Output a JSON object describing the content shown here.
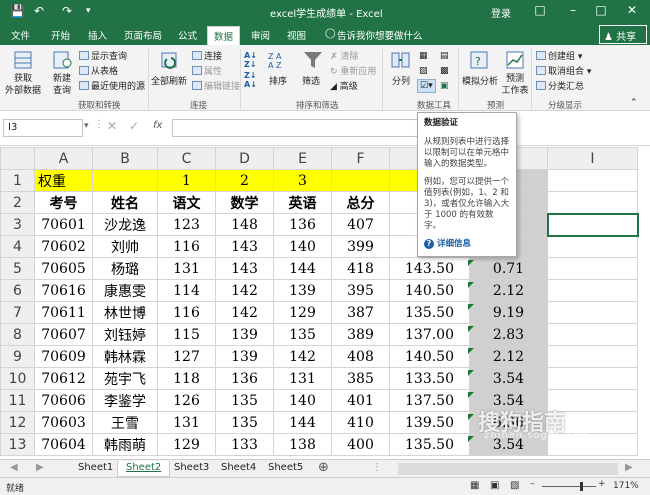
{
  "titlebar": {
    "title": "excel学生成绩单 - Excel",
    "login": "登录",
    "save_icon": "save-icon",
    "undo_icon": "undo-icon",
    "redo_icon": "redo-icon"
  },
  "tabs": [
    "文件",
    "开始",
    "插入",
    "页面布局",
    "公式",
    "数据",
    "审阅",
    "视图"
  ],
  "active_tab": "数据",
  "tell_me": "告诉我你想要做什么",
  "share": "共享",
  "ribbon": {
    "get_external": "获取\n外部数据",
    "new_query": "新建\n查询",
    "show_queries": "显示查询",
    "from_table": "从表格",
    "recent_sources": "最近使用的源",
    "group1": "获取和转换",
    "refresh_all": "全部刷新",
    "connections": "连接",
    "properties": "属性",
    "edit_links": "编辑链接",
    "group2": "连接",
    "sort": "排序",
    "filter": "筛选",
    "clear": "清除",
    "reapply": "重新应用",
    "advanced": "高级",
    "group3": "排序和筛选",
    "text_to_columns": "分列",
    "group4": "数据工具",
    "what_if": "模拟分析",
    "forecast_sheet": "预测\n工作表",
    "group5": "预测",
    "group": "创建组",
    "ungroup": "取消组合",
    "subtotal": "分类汇总",
    "group6": "分级显示"
  },
  "namebox": "I3",
  "tooltip": {
    "title": "数据验证",
    "p1": "从规则列表中进行选择以限制可以在单元格中输入的数据类型。",
    "p2": "例如，您可以提供一个值列表(例如，1、2 和 3)，或者仅允许输入大于 1000 的有效数字。",
    "more": "详细信息"
  },
  "columns": [
    "A",
    "B",
    "C",
    "D",
    "E",
    "F",
    "G",
    "H",
    "I"
  ],
  "rows": [
    {
      "n": "1",
      "cells": [
        "权重",
        "",
        "1",
        "2",
        "3",
        "",
        "",
        "分",
        ""
      ]
    },
    {
      "n": "2",
      "cells": [
        "考号",
        "姓名",
        "语文",
        "数学",
        "英语",
        "总分",
        "平",
        "差",
        ""
      ]
    },
    {
      "n": "3",
      "cells": [
        "70601",
        "沙龙逸",
        "123",
        "148",
        "136",
        "407",
        "14",
        "",
        ""
      ]
    },
    {
      "n": "4",
      "cells": [
        "70602",
        "刘帅",
        "116",
        "143",
        "140",
        "399",
        "14",
        "",
        ""
      ]
    },
    {
      "n": "5",
      "cells": [
        "70605",
        "杨璐",
        "131",
        "143",
        "144",
        "418",
        "143.50",
        "0.71",
        ""
      ]
    },
    {
      "n": "6",
      "cells": [
        "70616",
        "康惠雯",
        "114",
        "142",
        "139",
        "395",
        "140.50",
        "2.12",
        ""
      ]
    },
    {
      "n": "7",
      "cells": [
        "70611",
        "林世博",
        "116",
        "142",
        "129",
        "387",
        "135.50",
        "9.19",
        ""
      ]
    },
    {
      "n": "8",
      "cells": [
        "70607",
        "刘钰婷",
        "115",
        "139",
        "135",
        "389",
        "137.00",
        "2.83",
        ""
      ]
    },
    {
      "n": "9",
      "cells": [
        "70609",
        "韩林霖",
        "127",
        "139",
        "142",
        "408",
        "140.50",
        "2.12",
        ""
      ]
    },
    {
      "n": "10",
      "cells": [
        "70612",
        "苑宇飞",
        "118",
        "136",
        "131",
        "385",
        "133.50",
        "3.54",
        ""
      ]
    },
    {
      "n": "11",
      "cells": [
        "70606",
        "李鉴学",
        "126",
        "135",
        "140",
        "401",
        "137.50",
        "3.54",
        ""
      ]
    },
    {
      "n": "12",
      "cells": [
        "70603",
        "王雪",
        "131",
        "135",
        "144",
        "410",
        "139.50",
        "6.36",
        ""
      ]
    },
    {
      "n": "13",
      "cells": [
        "70604",
        "韩雨萌",
        "129",
        "133",
        "138",
        "400",
        "135.50",
        "3.54",
        ""
      ]
    }
  ],
  "sheets": [
    "Sheet1",
    "Sheet2",
    "Sheet3",
    "Sheet4",
    "Sheet5"
  ],
  "active_sheet": "Sheet2",
  "status": {
    "ready": "就绪",
    "zoom": "171%"
  },
  "watermark": {
    "text": "搜狗指南",
    "url": "zhinan.sogou.com"
  },
  "colors": {
    "excel_green": "#217346",
    "header_yellow": "#ffff00"
  }
}
